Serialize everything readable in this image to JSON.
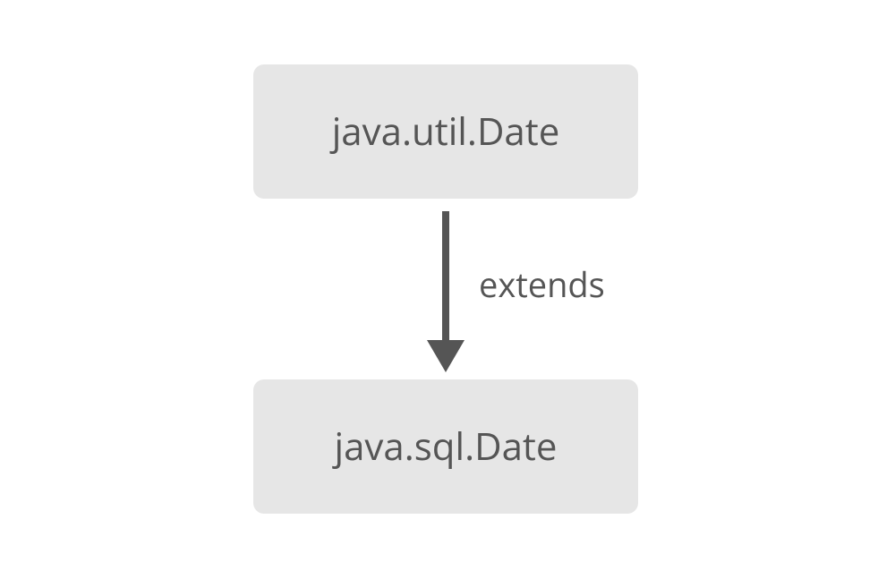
{
  "diagram": {
    "nodes": {
      "parent": "java.util.Date",
      "child": "java.sql.Date"
    },
    "edge": {
      "label": "extends"
    }
  }
}
